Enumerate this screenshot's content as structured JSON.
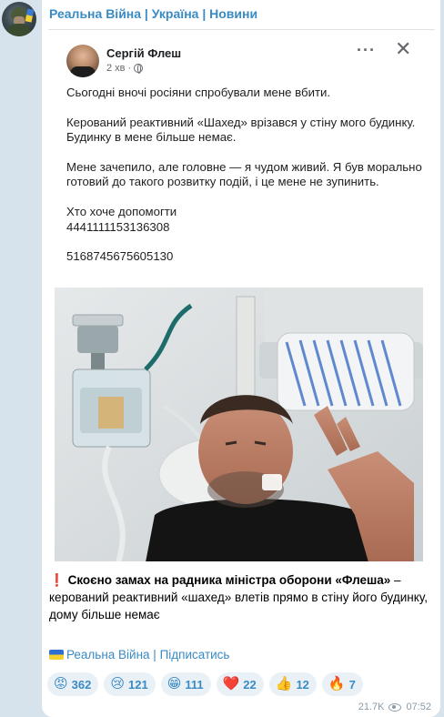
{
  "channel": {
    "title": "Реальна Війна | Україна | Новини",
    "link_text": "Реальна Війна | Підписатись"
  },
  "fb_post": {
    "author": "Сергій Флеш",
    "time": "2 хв",
    "more_icon": "more-icon",
    "close_icon": "close-icon",
    "paragraphs": [
      "Сьогодні вночі росіяни спробували мене вбити.",
      "Керований реактивний «Шахед» врізався у стіну мого будинку. Будинку в мене більше немає.",
      "Мене зачепило, але головне — я чудом живий.  Я був морально готовий до такого розвитку подій, і це мене не зупинить.",
      "Хто хоче допомогти",
      "4441111153136308",
      "5168745675605130"
    ]
  },
  "caption": {
    "warn_icon": "❗",
    "bold": "Скоєно замах на радника міністра оборони «Флеша»",
    "rest": " – керований реактивний «шахед» влетів прямо в стіну його будинку, дому більше немає"
  },
  "reactions": [
    {
      "icon": "angry-face-icon",
      "emoji": "😡",
      "count": "362"
    },
    {
      "icon": "crying-face-icon",
      "emoji": "😢",
      "count": "121"
    },
    {
      "icon": "grinning-face-icon",
      "emoji": "😁",
      "count": "111"
    },
    {
      "icon": "heart-icon",
      "emoji": "❤️",
      "count": "22"
    },
    {
      "icon": "thumbs-up-icon",
      "emoji": "👍",
      "count": "12"
    },
    {
      "icon": "fire-icon",
      "emoji": "🔥",
      "count": "7"
    }
  ],
  "footer": {
    "views": "21.7K",
    "time": "07:52"
  },
  "colors": {
    "link": "#3a8ac4",
    "background": "#d7e3ec",
    "warn": "#e0242b"
  }
}
